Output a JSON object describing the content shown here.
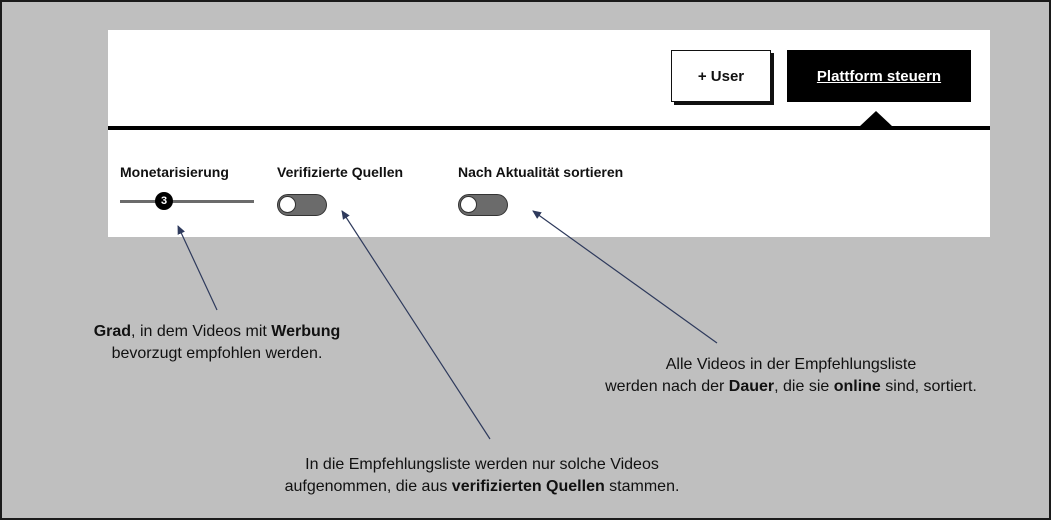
{
  "header": {
    "user_button_label": "+ User",
    "platform_button_label": "Plattform steuern"
  },
  "controls": {
    "monetization": {
      "label": "Monetarisierung",
      "value": "3"
    },
    "verified_sources": {
      "label": "Verifizierte Quellen",
      "state": "off"
    },
    "sort_recency": {
      "label": "Nach Aktualität sortieren",
      "state": "off"
    }
  },
  "annotations": {
    "monetization": {
      "l1_b1": "Grad",
      "l1_t1": ", in dem Videos mit ",
      "l1_b2": "Werbung",
      "l2": "bevorzugt empfohlen werden."
    },
    "recency": {
      "l1": "Alle Videos in der Empfehlungsliste",
      "l2_t1": "werden nach der ",
      "l2_b1": "Dauer",
      "l2_t2": ", die sie ",
      "l2_b2": "online",
      "l2_t3": " sind, sortiert."
    },
    "verified": {
      "l1": "In die Empfehlungsliste werden nur solche Videos",
      "l2_t1": "aufgenommen, die aus ",
      "l2_b1": "verifizierten Quellen",
      "l2_t2": " stammen."
    }
  },
  "colors": {
    "background": "#bfbfbf",
    "panel": "#ffffff",
    "toggle_off": "#6b6b6b",
    "arrow": "#2e3a5c"
  }
}
